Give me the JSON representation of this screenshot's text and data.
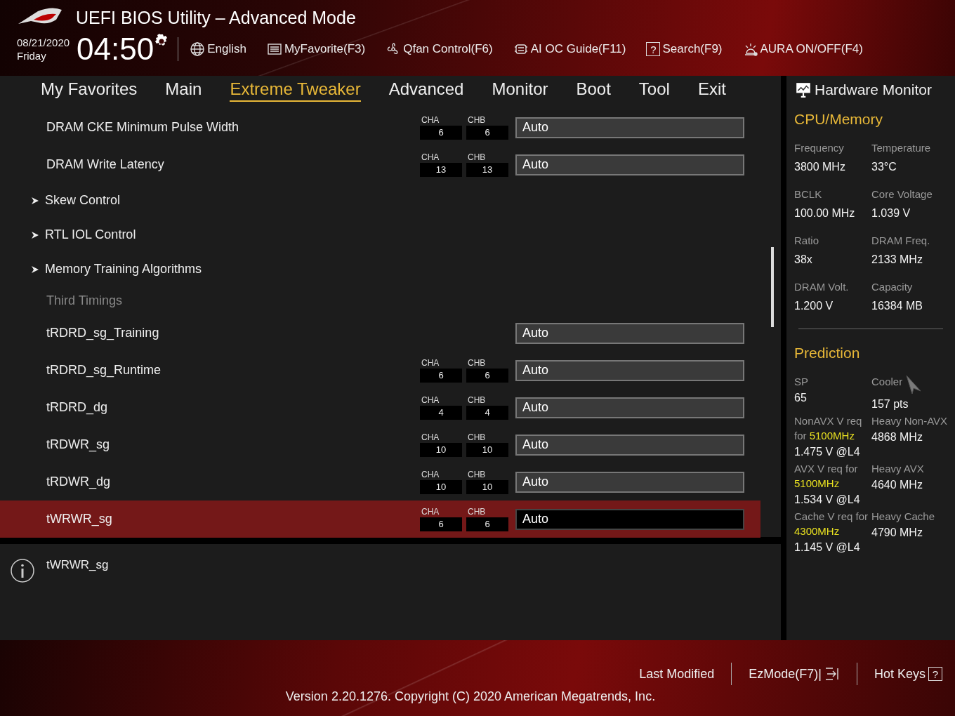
{
  "window": {
    "title": "UEFI BIOS Utility – Advanced Mode"
  },
  "clock": {
    "date": "08/21/2020",
    "day": "Friday",
    "time": "04:50"
  },
  "toolbar": [
    {
      "label": "English"
    },
    {
      "label": "MyFavorite(F3)"
    },
    {
      "label": "Qfan Control(F6)"
    },
    {
      "label": "AI OC Guide(F11)"
    },
    {
      "label": "Search(F9)",
      "icon_glyph": "?"
    },
    {
      "label": "AURA ON/OFF(F4)"
    }
  ],
  "tabs": [
    {
      "label": "My Favorites",
      "selected": false
    },
    {
      "label": "Main",
      "selected": false
    },
    {
      "label": "Extreme Tweaker",
      "selected": true
    },
    {
      "label": "Advanced",
      "selected": false
    },
    {
      "label": "Monitor",
      "selected": false
    },
    {
      "label": "Boot",
      "selected": false
    },
    {
      "label": "Tool",
      "selected": false
    },
    {
      "label": "Exit",
      "selected": false
    }
  ],
  "settings": [
    {
      "kind": "setting",
      "label": "DRAM CKE Minimum Pulse Width",
      "channels": [
        {
          "name": "CHA",
          "value": "6"
        },
        {
          "name": "CHB",
          "value": "6"
        }
      ],
      "value": "Auto",
      "selected": false
    },
    {
      "kind": "setting",
      "label": "DRAM Write Latency",
      "channels": [
        {
          "name": "CHA",
          "value": "13"
        },
        {
          "name": "CHB",
          "value": "13"
        }
      ],
      "value": "Auto",
      "selected": false
    },
    {
      "kind": "submenu",
      "label": "Skew Control",
      "selected": false
    },
    {
      "kind": "submenu",
      "label": "RTL IOL Control",
      "selected": false
    },
    {
      "kind": "submenu",
      "label": "Memory Training Algorithms",
      "selected": false
    },
    {
      "kind": "heading",
      "label": "Third Timings"
    },
    {
      "kind": "setting",
      "label": "tRDRD_sg_Training",
      "value": "Auto",
      "selected": false
    },
    {
      "kind": "setting",
      "label": "tRDRD_sg_Runtime",
      "channels": [
        {
          "name": "CHA",
          "value": "6"
        },
        {
          "name": "CHB",
          "value": "6"
        }
      ],
      "value": "Auto",
      "selected": false
    },
    {
      "kind": "setting",
      "label": "tRDRD_dg",
      "channels": [
        {
          "name": "CHA",
          "value": "4"
        },
        {
          "name": "CHB",
          "value": "4"
        }
      ],
      "value": "Auto",
      "selected": false
    },
    {
      "kind": "setting",
      "label": "tRDWR_sg",
      "channels": [
        {
          "name": "CHA",
          "value": "10"
        },
        {
          "name": "CHB",
          "value": "10"
        }
      ],
      "value": "Auto",
      "selected": false
    },
    {
      "kind": "setting",
      "label": "tRDWR_dg",
      "channels": [
        {
          "name": "CHA",
          "value": "10"
        },
        {
          "name": "CHB",
          "value": "10"
        }
      ],
      "value": "Auto",
      "selected": false
    },
    {
      "kind": "setting",
      "label": "tWRWR_sg",
      "channels": [
        {
          "name": "CHA",
          "value": "6"
        },
        {
          "name": "CHB",
          "value": "6"
        }
      ],
      "value": "Auto",
      "selected": true
    }
  ],
  "help": {
    "text": "tWRWR_sg"
  },
  "hardware_monitor": {
    "title": "Hardware Monitor",
    "sections": [
      {
        "title": "CPU/Memory",
        "items": [
          {
            "label": "Frequency",
            "value": "3800 MHz"
          },
          {
            "label": "Temperature",
            "value": "33°C"
          },
          {
            "label": "BCLK",
            "value": "100.00 MHz"
          },
          {
            "label": "Core Voltage",
            "value": "1.039 V"
          },
          {
            "label": "Ratio",
            "value": "38x"
          },
          {
            "label": "DRAM Freq.",
            "value": "2133 MHz"
          },
          {
            "label": "DRAM Volt.",
            "value": "1.200 V"
          },
          {
            "label": "Capacity",
            "value": "16384 MB"
          }
        ]
      },
      {
        "title": "Prediction",
        "items": [
          {
            "label": "SP",
            "value": "65"
          },
          {
            "label": "Cooler",
            "value": "157 pts"
          },
          {
            "label": "NonAVX V req for **5100MHz**",
            "value": "1.475 V @L4"
          },
          {
            "label": "Heavy Non-AVX",
            "value": "4868 MHz"
          },
          {
            "label": "AVX V req for **5100MHz**",
            "value": "1.534 V @L4"
          },
          {
            "label": "Heavy AVX",
            "value": "4640 MHz"
          },
          {
            "label": "Cache V req for **4300MHz**",
            "value": "1.145 V @L4"
          },
          {
            "label": "Heavy Cache",
            "value": "4790 MHz"
          }
        ]
      }
    ]
  },
  "footer": {
    "items": [
      {
        "label": "Last Modified"
      },
      {
        "label": "EzMode(F7)|"
      },
      {
        "label": "Hot Keys",
        "icon_glyph": "?"
      }
    ],
    "version": "Version 2.20.1276. Copyright (C) 2020 American Megatrends, Inc."
  }
}
